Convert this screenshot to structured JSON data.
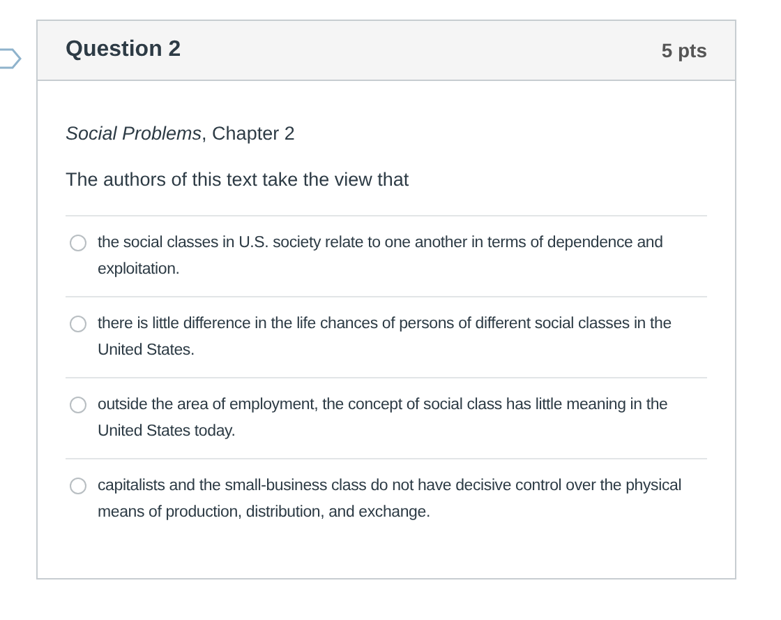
{
  "question": {
    "title": "Question 2",
    "points": "5 pts",
    "source": "*Social Problems*, Chapter 2",
    "prompt": "The authors of this text take the view that",
    "answers": [
      {
        "text": "the social classes in U.S. society relate to one another in terms of dependence and exploitation.",
        "selected": false
      },
      {
        "text": "there is little difference in the life chances of persons of different social classes in the United States.",
        "selected": false
      },
      {
        "text": "outside the area of employment, the concept of social class has little meaning in the United States today.",
        "selected": false
      },
      {
        "text": "capitalists and the small-business class do not have decisive control over the physical means of production, distribution, and exchange.",
        "selected": false
      }
    ]
  }
}
